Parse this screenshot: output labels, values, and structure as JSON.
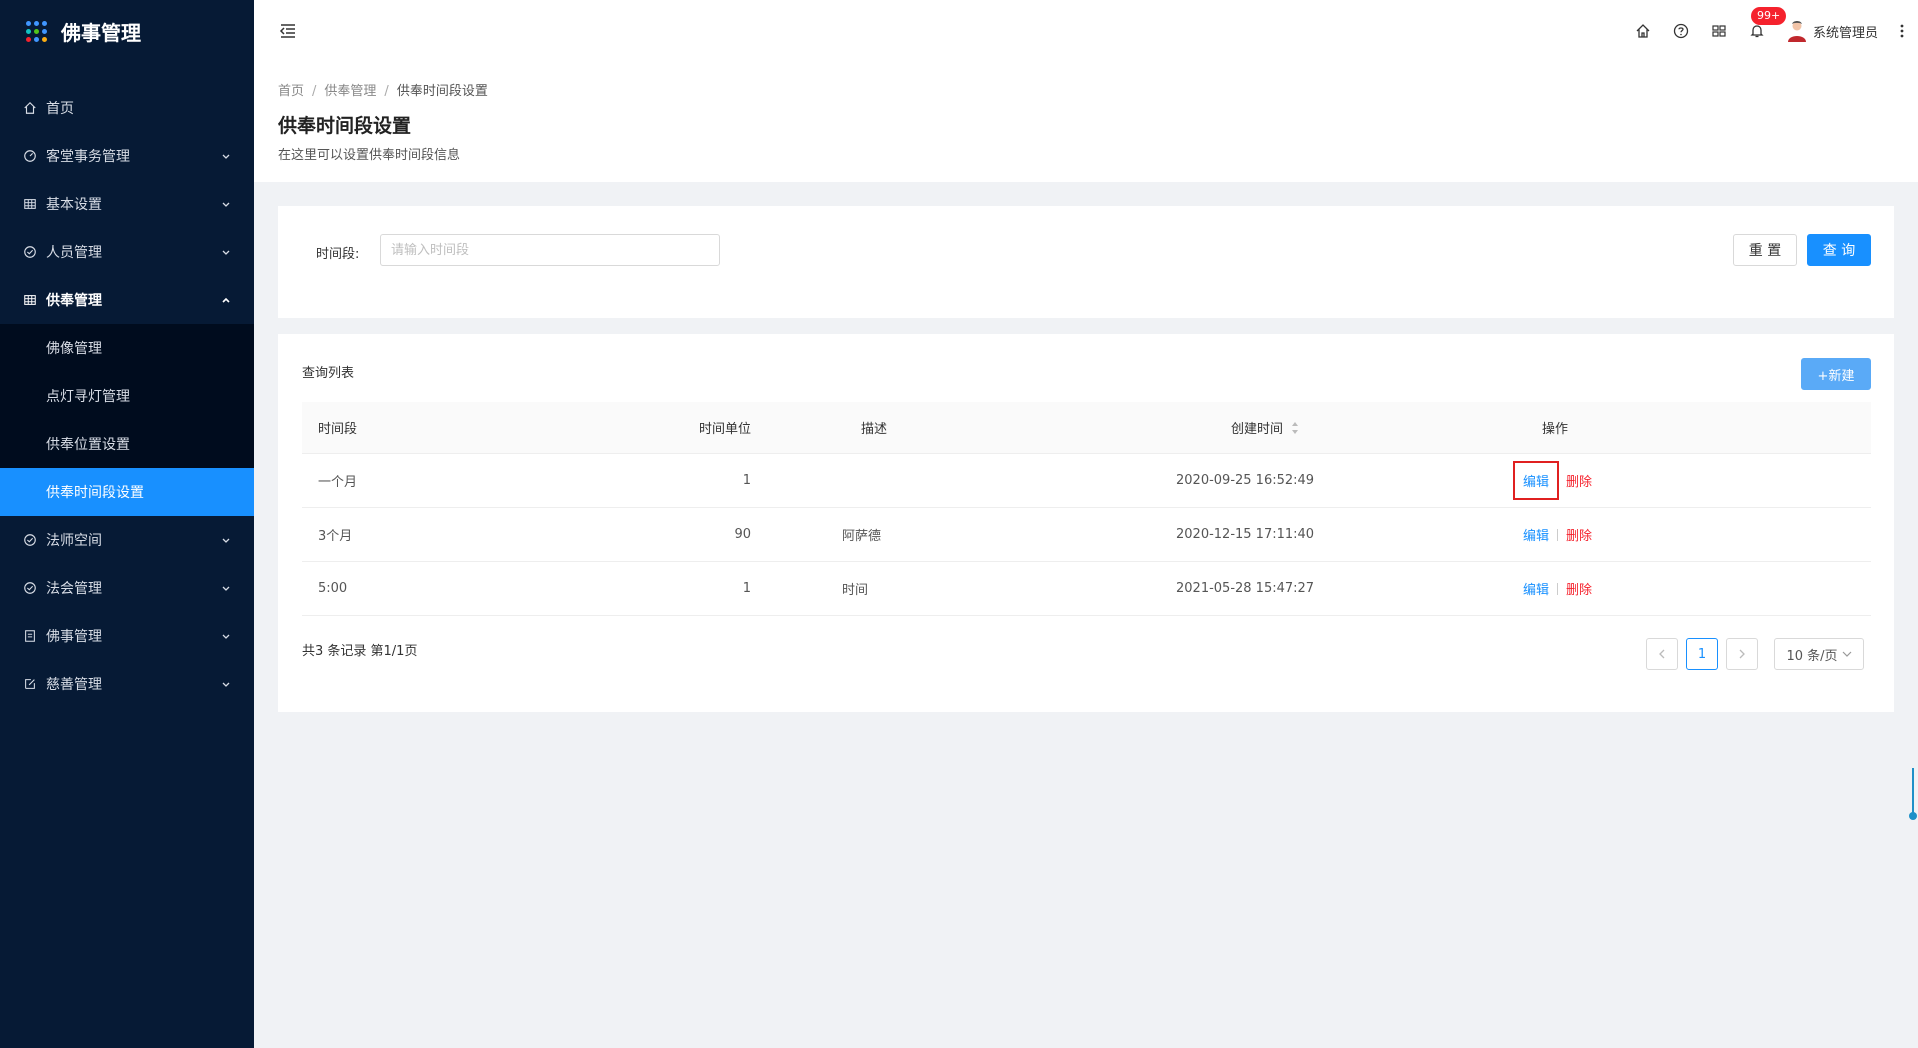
{
  "app": {
    "title": "佛事管理",
    "logo_colors": [
      "#4096ff",
      "#4096ff",
      "#4096ff",
      "#13c2c2",
      "#52c41a",
      "#4096ff",
      "#f5222d",
      "#4096ff",
      "#faad14"
    ]
  },
  "sidebar": {
    "items": [
      {
        "label": "首页",
        "icon": "home-icon",
        "has_children": false
      },
      {
        "label": "客堂事务管理",
        "icon": "dashboard-icon",
        "has_children": true
      },
      {
        "label": "基本设置",
        "icon": "table-icon",
        "has_children": true
      },
      {
        "label": "人员管理",
        "icon": "check-circle-icon",
        "has_children": true
      },
      {
        "label": "供奉管理",
        "icon": "table-icon",
        "has_children": true,
        "open": true,
        "children": [
          {
            "label": "佛像管理"
          },
          {
            "label": "点灯寻灯管理"
          },
          {
            "label": "供奉位置设置"
          },
          {
            "label": "供奉时间段设置",
            "active": true
          }
        ]
      },
      {
        "label": "法师空间",
        "icon": "check-circle-icon",
        "has_children": true
      },
      {
        "label": "法会管理",
        "icon": "check-circle-icon",
        "has_children": true
      },
      {
        "label": "佛事管理",
        "icon": "file-icon",
        "has_children": true
      },
      {
        "label": "慈善管理",
        "icon": "edit-icon",
        "has_children": true
      }
    ]
  },
  "header": {
    "notification_badge": "99+",
    "user_name": "系统管理员"
  },
  "breadcrumb": [
    "首页",
    "供奉管理",
    "供奉时间段设置"
  ],
  "page": {
    "title": "供奉时间段设置",
    "description": "在这里可以设置供奉时间段信息"
  },
  "search": {
    "label": "时间段:",
    "placeholder": "请输入时间段",
    "reset_label": "重 置",
    "query_label": "查 询"
  },
  "list": {
    "title": "查询列表",
    "new_label": "+新建",
    "columns": [
      "时间段",
      "时间单位",
      "描述",
      "创建时间",
      "操作"
    ],
    "rows": [
      {
        "period": "一个月",
        "unit": "1",
        "desc": "",
        "created": "2020-09-25 16:52:49"
      },
      {
        "period": "3个月",
        "unit": "90",
        "desc": "阿萨德",
        "created": "2020-12-15 17:11:40"
      },
      {
        "period": "5:00",
        "unit": "1",
        "desc": "时间",
        "created": "2021-05-28 15:47:27"
      }
    ],
    "edit_label": "编辑",
    "delete_label": "删除"
  },
  "pagination": {
    "summary": "共3 条记录 第1/1页",
    "current_page": "1",
    "page_size": "10 条/页"
  },
  "colors": {
    "sidebar_bg": "#061a35",
    "active": "#1890ff",
    "danger": "#f5222d",
    "highlight_box": "#e02020"
  }
}
